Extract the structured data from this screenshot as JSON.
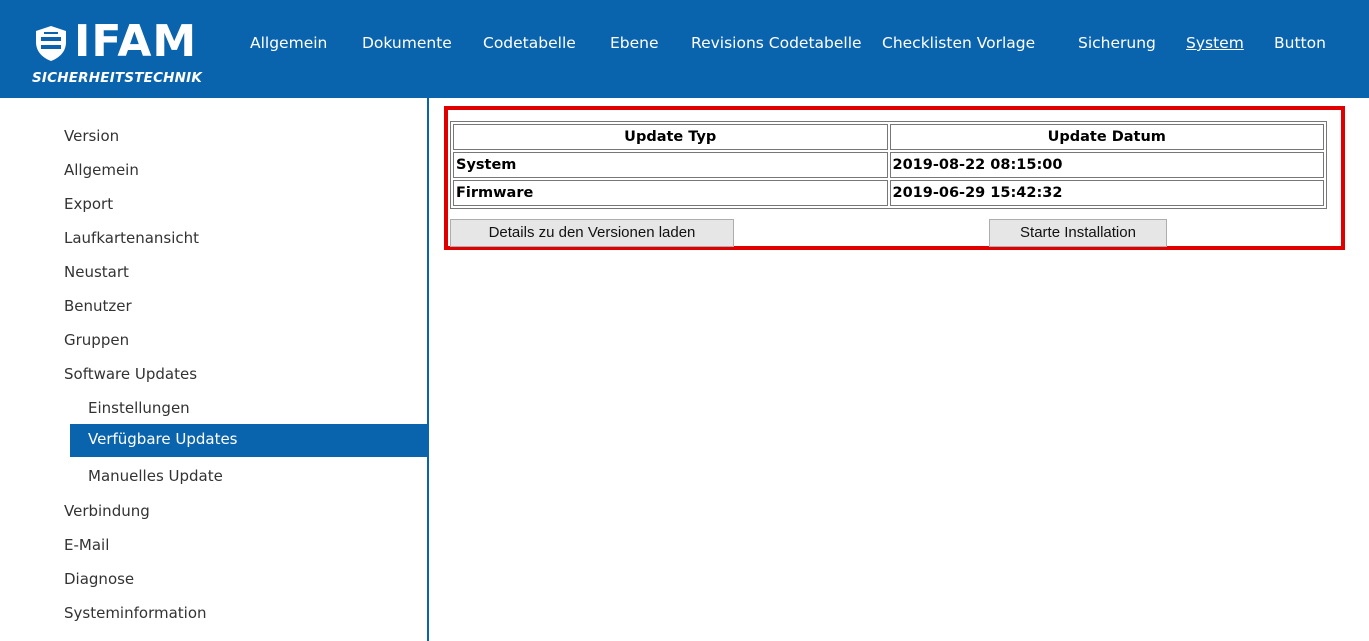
{
  "brand": {
    "name": "IFAM",
    "tagline": "SICHERHEITSTECHNIK",
    "color": "#0a64ad"
  },
  "nav": {
    "items": [
      {
        "label": "Allgemein"
      },
      {
        "label": "Dokumente"
      },
      {
        "label": "Codetabelle"
      },
      {
        "label": "Ebene"
      },
      {
        "label": "Revisions Codetabelle"
      },
      {
        "label": "Checklisten Vorlage"
      },
      {
        "label": "Sicherung"
      },
      {
        "label": "System",
        "active": true
      },
      {
        "label": "Button"
      }
    ]
  },
  "sidebar": {
    "items": [
      {
        "label": "Version"
      },
      {
        "label": "Allgemein"
      },
      {
        "label": "Export"
      },
      {
        "label": "Laufkartenansicht"
      },
      {
        "label": "Neustart"
      },
      {
        "label": "Benutzer"
      },
      {
        "label": "Gruppen"
      },
      {
        "label": "Software Updates"
      },
      {
        "label": "Einstellungen"
      },
      {
        "label": "Verfügbare Updates",
        "selected": true
      },
      {
        "label": "Manuelles Update"
      },
      {
        "label": "Verbindung"
      },
      {
        "label": "E-Mail"
      },
      {
        "label": "Diagnose"
      },
      {
        "label": "Systeminformation"
      }
    ]
  },
  "updates": {
    "headers": [
      "Update Typ",
      "Update Datum"
    ],
    "rows": [
      [
        "System",
        "2019-08-22 08:15:00"
      ],
      [
        "Firmware",
        "2019-06-29 15:42:32"
      ]
    ],
    "details_button": "Details zu den Versionen laden",
    "install_button": "Starte Installation",
    "highlight_color": "#e00000"
  }
}
